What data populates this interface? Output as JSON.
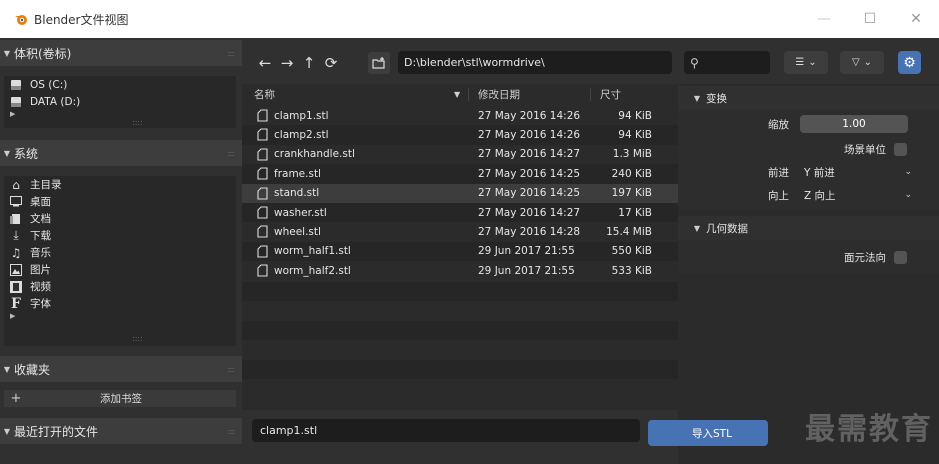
{
  "window": {
    "title": "Blender文件视图",
    "min_icon": "minimize-icon",
    "max_icon": "maximize-icon",
    "close_icon": "close-icon"
  },
  "sidebar": {
    "volumes": {
      "header": "体积(卷标)",
      "items": [
        {
          "label": "OS (C:)",
          "icon": "drive-icon"
        },
        {
          "label": "DATA (D:)",
          "icon": "drive-icon"
        }
      ]
    },
    "system": {
      "header": "系统",
      "items": [
        {
          "label": "主目录",
          "icon": "home-icon"
        },
        {
          "label": "桌面",
          "icon": "desktop-icon"
        },
        {
          "label": "文档",
          "icon": "documents-icon"
        },
        {
          "label": "下载",
          "icon": "download-icon"
        },
        {
          "label": "音乐",
          "icon": "music-icon"
        },
        {
          "label": "图片",
          "icon": "image-icon"
        },
        {
          "label": "视频",
          "icon": "video-icon"
        },
        {
          "label": "字体",
          "icon": "font-icon"
        }
      ]
    },
    "bookmarks": {
      "header": "收藏夹",
      "add_label": "添加书签"
    },
    "recent": {
      "header": "最近打开的文件"
    }
  },
  "toolbar": {
    "path": "D:\\blender\\stl\\wormdrive\\",
    "search_placeholder": ""
  },
  "columns": {
    "name": "名称",
    "date": "修改日期",
    "size": "尺寸"
  },
  "files": [
    {
      "name": "clamp1.stl",
      "date": "27 May 2016 14:26",
      "size": "94 KiB"
    },
    {
      "name": "clamp2.stl",
      "date": "27 May 2016 14:26",
      "size": "94 KiB"
    },
    {
      "name": "crankhandle.stl",
      "date": "27 May 2016 14:27",
      "size": "1.3 MiB"
    },
    {
      "name": "frame.stl",
      "date": "27 May 2016 14:25",
      "size": "240 KiB"
    },
    {
      "name": "stand.stl",
      "date": "27 May 2016 14:25",
      "size": "197 KiB"
    },
    {
      "name": "washer.stl",
      "date": "27 May 2016 14:27",
      "size": "17 KiB"
    },
    {
      "name": "wheel.stl",
      "date": "27 May 2016 14:28",
      "size": "15.4 MiB"
    },
    {
      "name": "worm_half1.stl",
      "date": "29 Jun 2017 21:55",
      "size": "550 KiB"
    },
    {
      "name": "worm_half2.stl",
      "date": "29 Jun 2017 21:55",
      "size": "533 KiB"
    }
  ],
  "filename_value": "clamp1.stl",
  "export_label": "导入STL",
  "options": {
    "transform": {
      "header": "变换",
      "scale_label": "缩放",
      "scale_value": "1.00",
      "scene_unit_label": "场景单位",
      "forward_label": "前进",
      "forward_value": "Y 前进",
      "up_label": "向上",
      "up_value": "Z 向上"
    },
    "geometry": {
      "header": "几何数据",
      "face_normals_label": "面元法向"
    }
  },
  "watermark": "最需教育",
  "colors": {
    "accent": "#4772b3",
    "logo": "#e87d0d"
  }
}
